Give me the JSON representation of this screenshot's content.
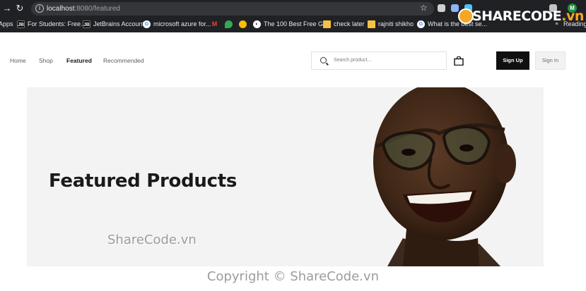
{
  "browser": {
    "url_host": "localhost",
    "url_rest": ":8080/featured",
    "avatar_initial": "M",
    "bookmarks": [
      {
        "label": "Apps",
        "icon": "apps-grid-icon"
      },
      {
        "label": "For Students: Free...",
        "icon": "jetbrains-icon"
      },
      {
        "label": "JetBrains Account",
        "icon": "jetbrains-icon"
      },
      {
        "label": "microsoft azure for...",
        "icon": "google-icon"
      },
      {
        "label": "",
        "icon": "gmail-icon"
      },
      {
        "label": "",
        "icon": "maps-icon"
      },
      {
        "label": "",
        "icon": "drive-icon"
      },
      {
        "label": "The 100 Best Free G...",
        "icon": "chrome-icon"
      },
      {
        "label": "check later",
        "icon": "folder-icon"
      },
      {
        "label": "rajniti shikho",
        "icon": "folder-icon"
      },
      {
        "label": "What is the best se...",
        "icon": "google-icon"
      },
      {
        "label": "Reading list",
        "icon": "reading-list-icon"
      }
    ]
  },
  "watermark_logo": {
    "main": "SHARECODE",
    "suffix": ".vn"
  },
  "header": {
    "nav": [
      "Home",
      "Shop",
      "Featured",
      "Recommended"
    ],
    "active_nav": "Featured",
    "search_placeholder": "Search product...",
    "signup_label": "Sign Up",
    "signin_label": "Sign In"
  },
  "banner": {
    "title": "Featured Products"
  },
  "watermarks": {
    "center": "ShareCode.vn",
    "footer": "Copyright © ShareCode.vn"
  },
  "colors": {
    "chrome_bg": "#202124",
    "banner_bg": "#f3f3f3",
    "signup_bg": "#101010",
    "logo_accent": "#f5a623"
  }
}
